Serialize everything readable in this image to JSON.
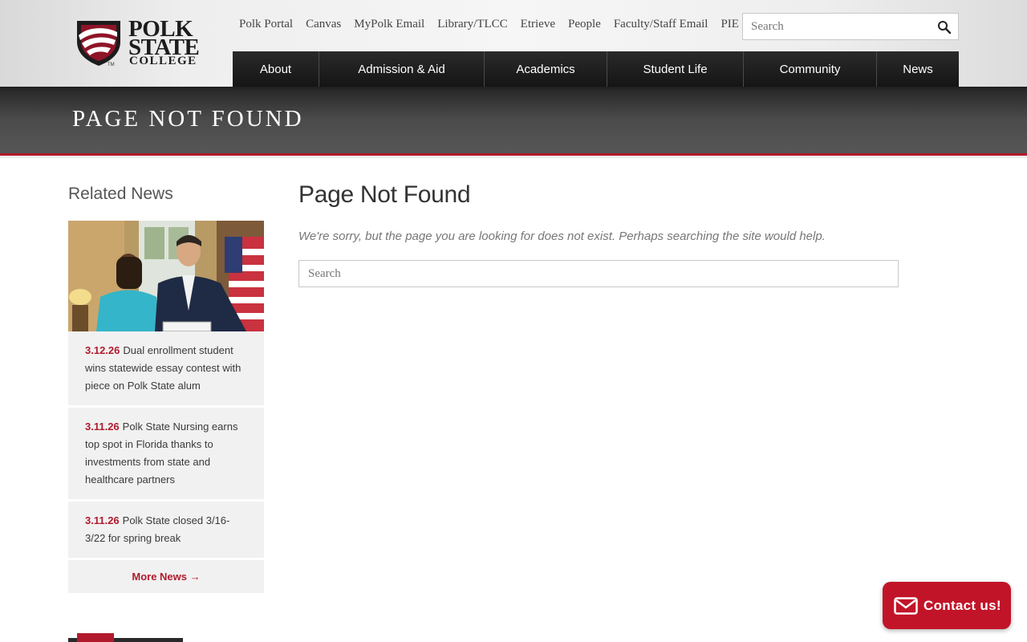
{
  "header": {
    "logo": {
      "line1": "POLK",
      "line2": "STATE",
      "line3": "COLLEGE",
      "trademark": "TM"
    },
    "utility_links": [
      {
        "label": "Polk Portal"
      },
      {
        "label": "Canvas"
      },
      {
        "label": "MyPolk Email"
      },
      {
        "label": "Library/TLCC"
      },
      {
        "label": "Etrieve"
      },
      {
        "label": "People"
      },
      {
        "label": "Faculty/Staff Email"
      },
      {
        "label": "PIE"
      }
    ],
    "search": {
      "placeholder": "Search",
      "icon": "search-icon"
    },
    "main_nav": [
      {
        "label": "About"
      },
      {
        "label": "Admission & Aid"
      },
      {
        "label": "Academics"
      },
      {
        "label": "Student Life"
      },
      {
        "label": "Community"
      },
      {
        "label": "News"
      }
    ]
  },
  "banner": {
    "title": "PAGE NOT FOUND"
  },
  "sidebar": {
    "heading": "Related News",
    "news": [
      {
        "date": "3.12.26",
        "text": "Dual enrollment student wins statewide essay contest with piece on Polk State alum"
      },
      {
        "date": "3.11.26",
        "text": "Polk State Nursing earns top spot in Florida thanks to investments from state and healthcare partners"
      },
      {
        "date": "3.11.26",
        "text": "Polk State closed 3/16-3/22 for spring break"
      }
    ],
    "more_label": "More News →"
  },
  "main": {
    "heading": "Page Not Found",
    "message": "We're sorry, but the page you are looking for does not exist. Perhaps searching the site would help.",
    "search_placeholder": "Search"
  },
  "contact": {
    "label": "Contact us!",
    "icon": "envelope-icon"
  },
  "colors": {
    "accent": "#b11a2d",
    "nav_bg": "#1b1b1b",
    "banner_bg": "#4a4a4a",
    "card_bg": "#f1f1f1"
  }
}
